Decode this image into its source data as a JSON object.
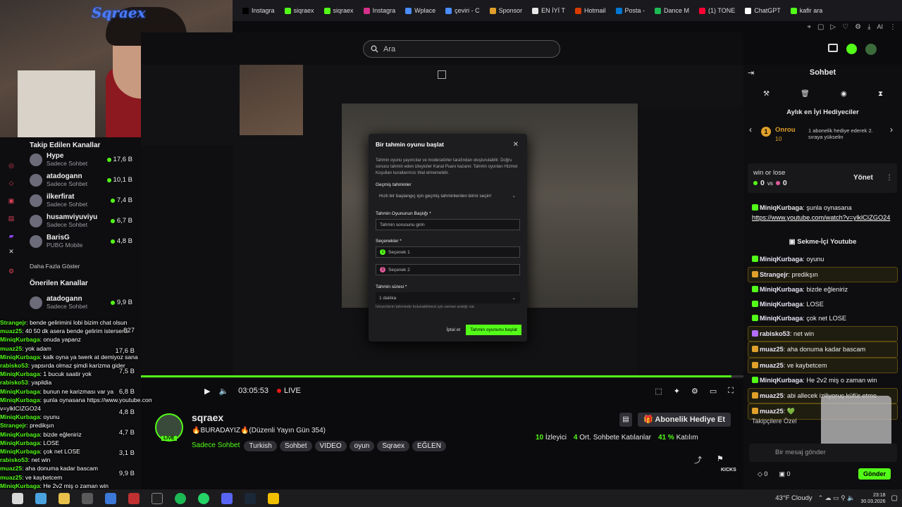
{
  "browser": {
    "logo": "Sqraex",
    "tabs": [
      "Instagra",
      "siqraex",
      "siqraex",
      "Instagra",
      "Wplace",
      "çeviri - C",
      "Sponsor",
      "EN İYİ T",
      "Hotmail",
      "Posta -",
      "Dance M",
      "(1) TONE",
      "ChatGPT",
      "kafir ara"
    ],
    "tab_colors": [
      "#000000",
      "#53fc18",
      "#53fc18",
      "#d6308a",
      "#4b8cff",
      "#4b8cff",
      "#e0a02a",
      "#e8e8e8",
      "#d83b01",
      "#0078d4",
      "#1db954",
      "#ff0033",
      "#ffffff",
      "#53fc18"
    ]
  },
  "search": {
    "placeholder": "Ara"
  },
  "sidebar": {
    "followed_title": "Takip Edilen Kanallar",
    "followed": [
      {
        "name": "Hype",
        "sub": "Sadece Sohbet",
        "viewers": "17,6 B"
      },
      {
        "name": "atadogann",
        "sub": "Sadece Sohbet",
        "viewers": "10,1 B"
      },
      {
        "name": "ilkerfirat",
        "sub": "Sadece Sohbet",
        "viewers": "7,4 B"
      },
      {
        "name": "husamviyuviyu",
        "sub": "Sadece Sohbet",
        "viewers": "6,7 B"
      },
      {
        "name": "BarisG",
        "sub": "PUBG Mobile",
        "viewers": "4,8 B"
      }
    ],
    "show_more": "Daha Fazla Göster",
    "recommended_title": "Önerilen Kanallar",
    "recommended": [
      {
        "name": "atadogann",
        "sub": "Sadece Sohbet",
        "viewers": "9,9 B"
      }
    ]
  },
  "overlay_chat": [
    {
      "u": "Strangejr",
      "t": "bende gelirimini lobi bizim chat olsun"
    },
    {
      "u": "muaz25",
      "t": "40 50 dk asera bende gelirim istersenz"
    },
    {
      "u": "MiniqKurbaga",
      "t": "onuda yapanz"
    },
    {
      "u": "muaz25",
      "t": "yok adam"
    },
    {
      "u": "MiniqKurbaga",
      "t": "kalk oyna ya twerk at demiyoz sana"
    },
    {
      "u": "rabisko53",
      "t": "yapsırda olmaz şimdi karizma gider"
    },
    {
      "u": "MiniqKurbaga",
      "t": "1 bucuk saatir yok"
    },
    {
      "u": "rabisko53",
      "t": "yapildia"
    },
    {
      "u": "MiniqKurbaga",
      "t": "bunun ne karizması var ya"
    },
    {
      "u": "MiniqKurbaga",
      "t": "şunla oynasana https://www.youtube.com/watch?"
    },
    {
      "u": "",
      "t": "v=ylklCIZGO24"
    },
    {
      "u": "MiniqKurbaga",
      "t": "oyunu"
    },
    {
      "u": "Strangejr",
      "t": "predikşın"
    },
    {
      "u": "MiniqKurbaga",
      "t": "bizde eğleniriz"
    },
    {
      "u": "MiniqKurbaga",
      "t": "LOSE"
    },
    {
      "u": "MiniqKurbaga",
      "t": "çok net LOSE"
    },
    {
      "u": "rabisko53",
      "t": "net win"
    },
    {
      "u": "muaz25",
      "t": "aha donuma kadar bascam"
    },
    {
      "u": "muaz25",
      "t": "ve kaybetcem"
    },
    {
      "u": "MiniqKurbaga",
      "t": "He 2v2 miş o zaman win"
    },
    {
      "u": "muaz25",
      "t": "abi allecek iziliyoruç küfür etme"
    },
    {
      "u": "muaz25",
      "t": ""
    }
  ],
  "overlay_viewers": [
    "827",
    "17,6 B",
    "7,5 B",
    "6,8 B",
    "4,8 B",
    "4,7 B",
    "3,1 B",
    "9,9 B"
  ],
  "modal": {
    "title": "Bir tahmin oyunu başlat",
    "description": "Tahmin oyunu yayıncılar ve moderatörler tarafından oluşturulabilir. Doğru sonucu tahmin eden izleyiciler Kanal Puanı kazanır. Tahmin oyunları Hizmet Koşulları kurallarımızı ihlal etmemelidir.",
    "history_label": "Geçmiş tahminler",
    "history_placeholder": "Hızlı bir başlangıç için geçmiş tahminlerden birini seçin!",
    "title_label": "Tahmin Oyununun Başlığı *",
    "title_placeholder": "Tahmin sorusunu girin",
    "options_label": "Seçenekler *",
    "option1": "Seçenek 1",
    "option2": "Seçenek 2",
    "duration_label": "Tahmin süresi *",
    "duration_value": "1 dakika",
    "duration_hint": "İzleyicilerin tahminde bulunabilmesi için zaman aralığı var.",
    "cancel": "İptal et",
    "start": "Tahmin oyununu başlat"
  },
  "player": {
    "time": "03:05:53",
    "live": "LIVE",
    "progress": 0.98
  },
  "stream": {
    "channel": "sqraex",
    "title": "🔥BURADAYIZ🔥(Düzenli Yayın Gün 354)",
    "category": "Sadece Sohbet",
    "tags": [
      "Turkish",
      "Sohbet",
      "VIDEO",
      "oyun",
      "Sqraex",
      "EĞLEN"
    ],
    "live_badge": "LIVE",
    "viewers_count": "10",
    "viewers_label": "İzleyici",
    "avg_count": "4",
    "avg_label": "Ort. Sohbete Katılanlar",
    "part_count": "41 %",
    "part_label": "Katılım",
    "sub_gift": "Abonelik Hediye Et"
  },
  "chat": {
    "title": "Sohbet",
    "gifters_title": "Aylık en İyi Hediyeciler",
    "gifter_name": "Onrou",
    "gifter_count": "10",
    "gifter_note": "1 abonelik hediye ederek 2. sıraya yükselin",
    "prediction_title": "win or lose",
    "prediction_left": "0",
    "prediction_vs": "vs",
    "prediction_right": "0",
    "manage": "Yönet",
    "pinned_user": "MiniqKurbaga",
    "pinned_text": "şunla oynasana",
    "pinned_link": "https://www.youtube.com/watch?v=ylklCIZGO24",
    "youtube_card": "Sekme-İçi Youtube",
    "messages": [
      {
        "u": "MiniqKurbaga",
        "t": "oyunu",
        "b": "g"
      },
      {
        "u": "Strangejr",
        "t": "predikşın",
        "b": "y",
        "hl": true
      },
      {
        "u": "MiniqKurbaga",
        "t": "bizde eğleniriz",
        "b": "g"
      },
      {
        "u": "MiniqKurbaga",
        "t": "LOSE",
        "b": "g"
      },
      {
        "u": "MiniqKurbaga",
        "t": "çok net LOSE",
        "b": "g"
      },
      {
        "u": "rabisko53",
        "t": "net win",
        "b": "p",
        "hl": true
      },
      {
        "u": "muaz25",
        "t": "aha donuma kadar bascam",
        "b": "y",
        "hl": true
      },
      {
        "u": "muaz25",
        "t": "ve kaybetcem",
        "b": "y",
        "hl": true
      },
      {
        "u": "MiniqKurbaga",
        "t": "He 2v2 miş o zaman win",
        "b": "g"
      },
      {
        "u": "muaz25",
        "t": "abi allecek iziliyoruç küfür etme",
        "b": "y",
        "hl": true
      },
      {
        "u": "muaz25",
        "t": "💚",
        "b": "y",
        "hl": true
      }
    ],
    "follower_special": "Takipçilere Özel",
    "input_placeholder": "Bir mesaj gönder",
    "kicks": "KICKS",
    "points_a": "0",
    "points_b": "0",
    "send": "Gönder"
  },
  "taskbar": {
    "weather": "43°F Cloudy",
    "time": "23:18",
    "date": "30.03.2026"
  }
}
